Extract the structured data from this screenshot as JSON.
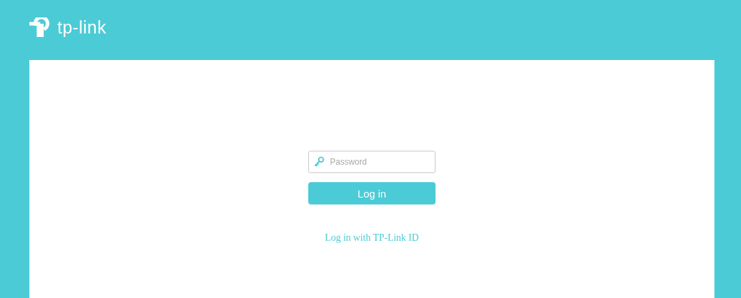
{
  "header": {
    "logo_text": "tp-link"
  },
  "login": {
    "password": {
      "placeholder": "Password"
    },
    "button": "Log in",
    "link": "Log in with TP-Link ID"
  }
}
